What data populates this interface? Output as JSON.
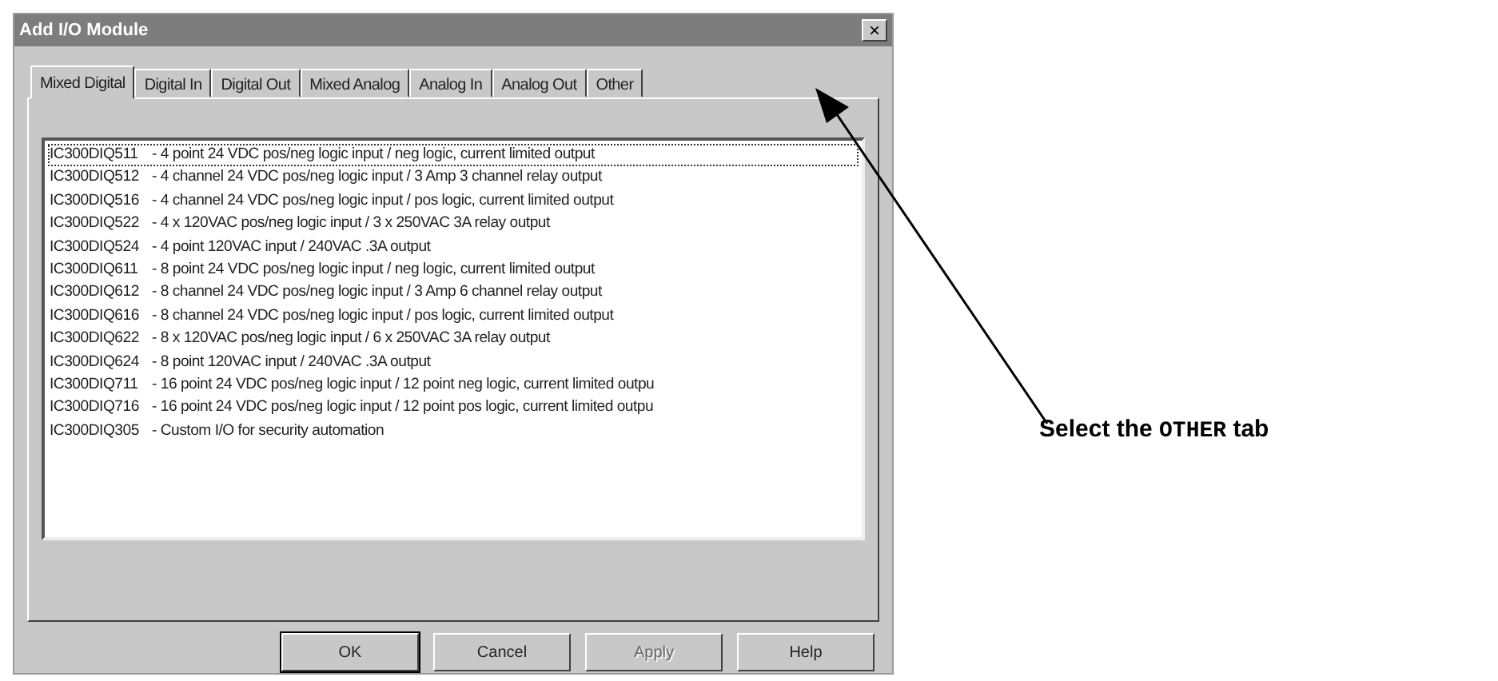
{
  "window": {
    "title": "Add I/O Module",
    "close": "×"
  },
  "tabs": [
    {
      "label": "Mixed Digital",
      "selected": true
    },
    {
      "label": "Digital In",
      "selected": false
    },
    {
      "label": "Digital Out",
      "selected": false
    },
    {
      "label": "Mixed Analog",
      "selected": false
    },
    {
      "label": "Analog In",
      "selected": false
    },
    {
      "label": "Analog Out",
      "selected": false
    },
    {
      "label": "Other",
      "selected": false
    }
  ],
  "modules": [
    {
      "code": "IC300DIQ511",
      "description": "-  4 point 24 VDC pos/neg logic input / neg logic, current limited output",
      "focused": true
    },
    {
      "code": "IC300DIQ512",
      "description": "-  4 channel 24 VDC pos/neg logic input / 3 Amp 3 channel relay output",
      "focused": false
    },
    {
      "code": "IC300DIQ516",
      "description": "-  4 channel 24 VDC pos/neg logic input / pos logic, current limited output",
      "focused": false
    },
    {
      "code": "IC300DIQ522",
      "description": "-  4 x 120VAC pos/neg logic input / 3 x 250VAC 3A relay output",
      "focused": false
    },
    {
      "code": "IC300DIQ524",
      "description": "-  4 point 120VAC input / 240VAC .3A output",
      "focused": false
    },
    {
      "code": "IC300DIQ611",
      "description": "-  8 point 24 VDC pos/neg logic input / neg logic, current limited output",
      "focused": false
    },
    {
      "code": "IC300DIQ612",
      "description": "-  8 channel 24 VDC pos/neg logic input / 3 Amp 6 channel relay output",
      "focused": false
    },
    {
      "code": "IC300DIQ616",
      "description": "-  8 channel 24 VDC pos/neg logic input / pos logic, current limited output",
      "focused": false
    },
    {
      "code": "IC300DIQ622",
      "description": "-  8 x 120VAC pos/neg logic input / 6 x 250VAC 3A relay output",
      "focused": false
    },
    {
      "code": "IC300DIQ624",
      "description": "-  8 point 120VAC input / 240VAC .3A output",
      "focused": false
    },
    {
      "code": "IC300DIQ711",
      "description": "-  16 point 24 VDC pos/neg logic input / 12 point neg logic, current limited outpu",
      "focused": false
    },
    {
      "code": "IC300DIQ716",
      "description": "-  16 point 24 VDC pos/neg logic input / 12 point pos logic, current limited outpu",
      "focused": false
    },
    {
      "code": "IC300DIQ305",
      "description": "-  Custom I/O for security automation",
      "focused": false
    }
  ],
  "buttons": [
    {
      "label": "OK",
      "disabled": false,
      "default": true
    },
    {
      "label": "Cancel",
      "disabled": false,
      "default": false
    },
    {
      "label": "Apply",
      "disabled": true,
      "default": false
    },
    {
      "label": "Help",
      "disabled": false,
      "default": false
    }
  ],
  "annotation": {
    "text": "Select the **OTHER** tab"
  }
}
